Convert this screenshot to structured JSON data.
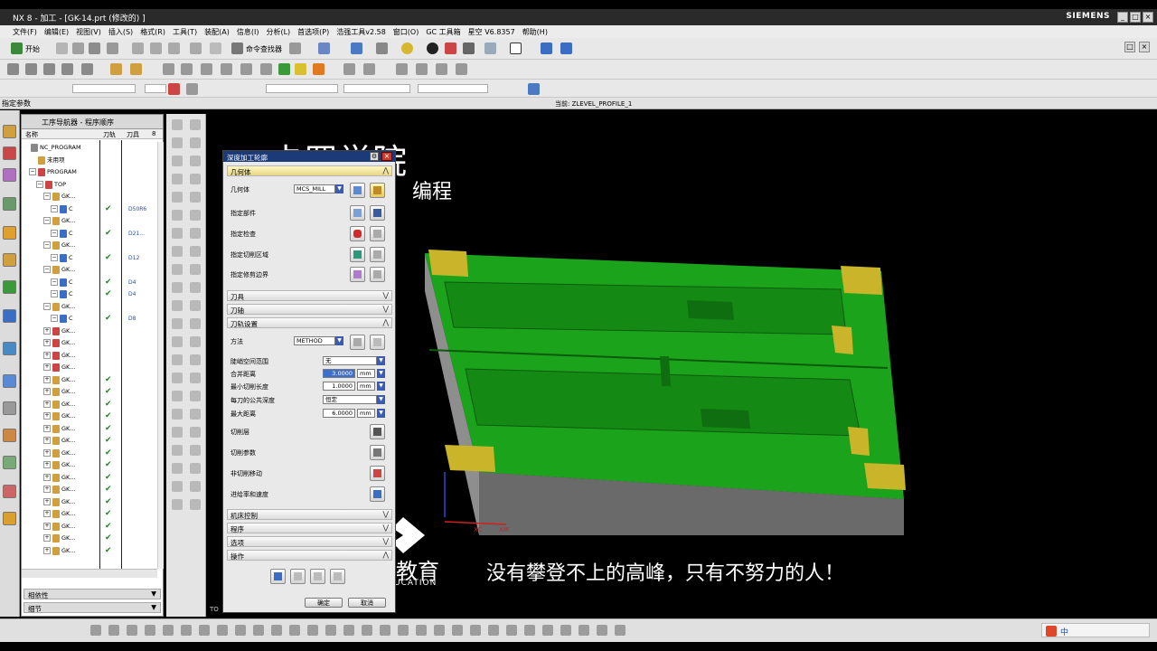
{
  "window": {
    "title": "NX 8 - 加工 - [GK-14.prt (修改的) ]",
    "brand": "SIEMENS"
  },
  "menu": [
    "文件(F)",
    "编辑(E)",
    "视图(V)",
    "插入(S)",
    "格式(R)",
    "工具(T)",
    "装配(A)",
    "信息(I)",
    "分析(L)",
    "首选项(P)",
    "浩强工具v2.58",
    "窗口(O)",
    "GC 工具箱",
    "星空 V6.8357",
    "帮助(H)"
  ],
  "toolbar": {
    "start_label": "开始",
    "command_finder": "命令查找器"
  },
  "selbar": {
    "left_label": "指定参数",
    "current_label": "当前: ZLEVEL_PROFILE_1"
  },
  "navigator": {
    "title": "工序导航器 - 程序顺序",
    "columns": [
      "名称",
      "刀轨",
      "刀具",
      "8"
    ],
    "rows": [
      {
        "label": "NC_PROGRAM",
        "tool": ""
      },
      {
        "label": "未用项",
        "tool": ""
      },
      {
        "label": "PROGRAM",
        "tool": ""
      },
      {
        "label": "TOP",
        "tool": ""
      },
      {
        "label": "GK...",
        "tool": ""
      },
      {
        "label": "C",
        "tool": "D50R6"
      },
      {
        "label": "GK...",
        "tool": ""
      },
      {
        "label": "C",
        "tool": "D21..."
      },
      {
        "label": "GK...",
        "tool": ""
      },
      {
        "label": "C",
        "tool": "D12"
      },
      {
        "label": "GK...",
        "tool": ""
      },
      {
        "label": "C",
        "tool": "D4"
      },
      {
        "label": "C",
        "tool": "D4"
      },
      {
        "label": "GK...",
        "tool": ""
      },
      {
        "label": "C",
        "tool": "D8"
      },
      {
        "label": "GK...",
        "tool": ""
      },
      {
        "label": "GK...",
        "tool": ""
      },
      {
        "label": "GK...",
        "tool": ""
      },
      {
        "label": "GK...",
        "tool": ""
      },
      {
        "label": "GK...",
        "tool": ""
      },
      {
        "label": "GK...",
        "tool": ""
      },
      {
        "label": "GK...",
        "tool": ""
      },
      {
        "label": "GK...",
        "tool": ""
      },
      {
        "label": "GK...",
        "tool": ""
      },
      {
        "label": "GK...",
        "tool": ""
      },
      {
        "label": "GK...",
        "tool": ""
      },
      {
        "label": "GK...",
        "tool": ""
      },
      {
        "label": "GK...",
        "tool": ""
      },
      {
        "label": "GK...",
        "tool": ""
      },
      {
        "label": "GK...",
        "tool": ""
      },
      {
        "label": "GK...",
        "tool": ""
      },
      {
        "label": "GK...",
        "tool": ""
      },
      {
        "label": "GK...",
        "tool": ""
      },
      {
        "label": "GK...",
        "tool": ""
      }
    ],
    "dependency_label": "相依性",
    "details_label": "细节"
  },
  "dialog": {
    "title": "深度加工轮廓",
    "geometry_section": "几何体",
    "geometry_label": "几何体",
    "geometry_value": "MCS_MILL",
    "specify_part": "指定部件",
    "specify_check": "指定检查",
    "specify_cut_area": "指定切削区域",
    "specify_trim": "指定修剪边界",
    "tool_section": "刀具",
    "axis_section": "刀轴",
    "path_section": "刀轨设置",
    "method_label": "方法",
    "method_value": "METHOD",
    "steep_label": "陡峭空间范围",
    "steep_value": "无",
    "merge_label": "合并距离",
    "merge_value": "3.0000",
    "min_cut_label": "最小切削长度",
    "min_cut_value": "1.0000",
    "common_depth_label": "每刀的公共深度",
    "common_depth_value": "恒定",
    "max_dist_label": "最大距离",
    "max_dist_value": "6.0000",
    "unit": "mm",
    "cut_levels": "切削层",
    "cut_params": "切削参数",
    "non_cut": "非切削移动",
    "feeds": "进给率和速度",
    "machine_section": "机床控制",
    "program_section": "程序",
    "options_section": "选项",
    "actions_section": "操作",
    "ok": "确定",
    "cancel": "取消"
  },
  "overlay": {
    "title": "卡罗学院",
    "subtitle": "编程",
    "slogan": "没有攀登不上的高峰，只有不努力的人！",
    "edu": "教育",
    "edu_en": "UCATION",
    "axis_xc": "XC",
    "axis_xm": "XM",
    "corner_label": "TO"
  },
  "colors": {
    "model_green": "#1fa81f",
    "pad_yellow": "#c9b42a",
    "dialog_title": "#1c3a78"
  }
}
